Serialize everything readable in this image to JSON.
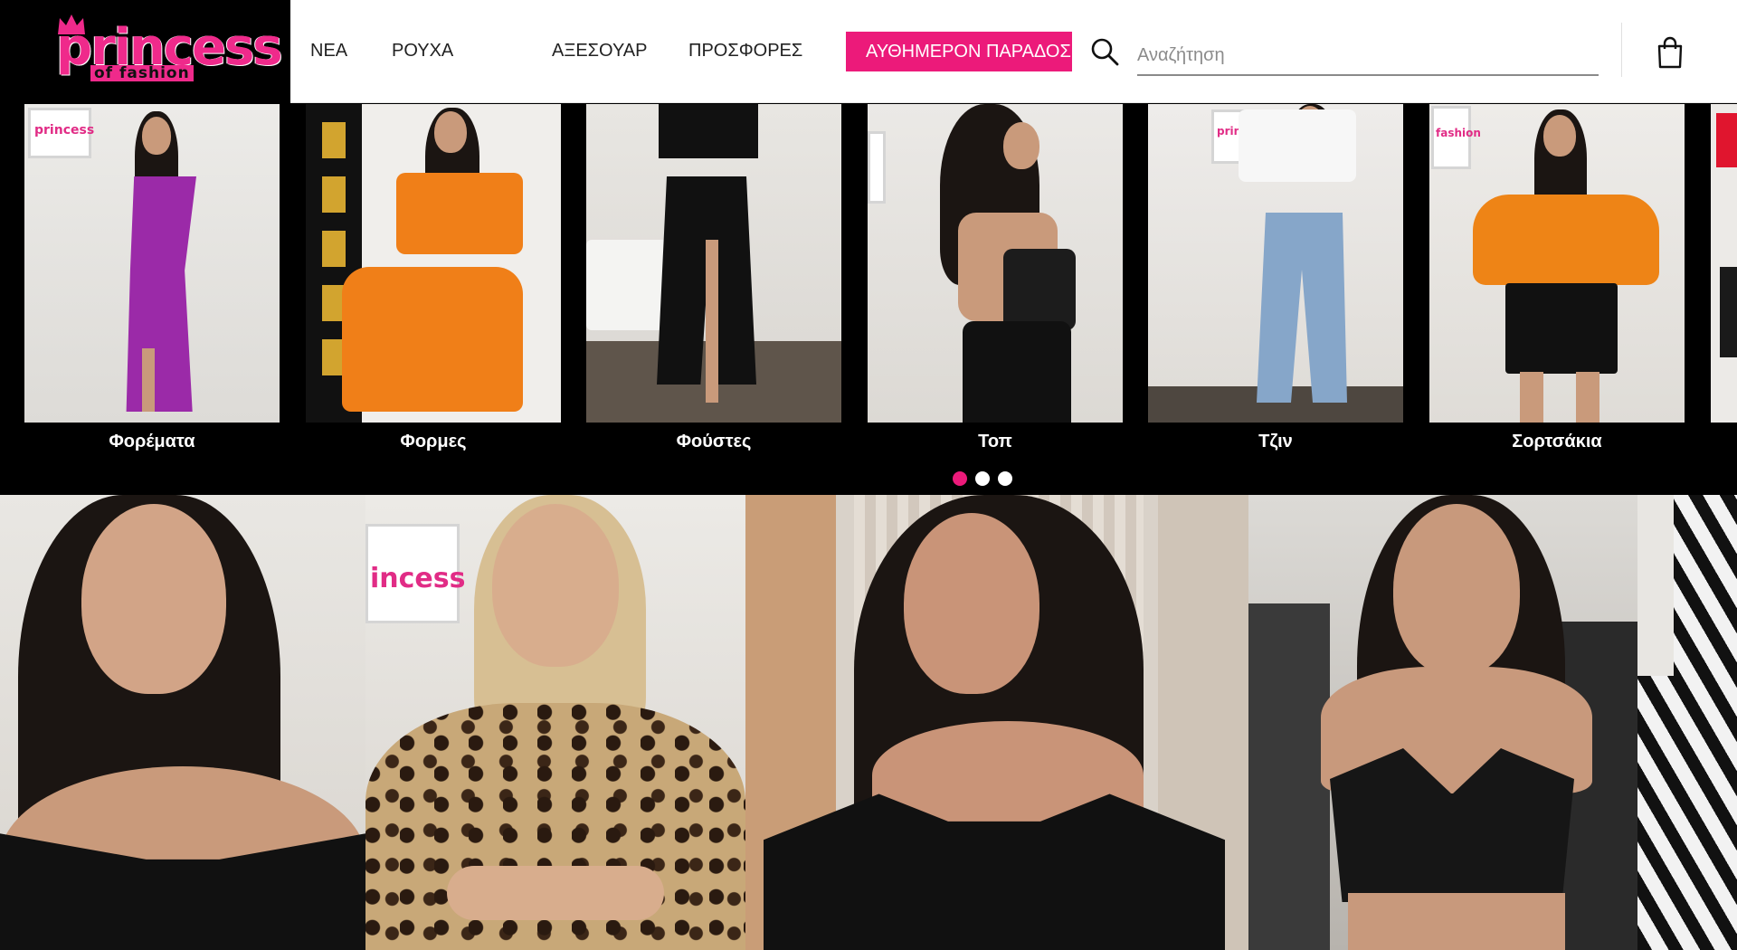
{
  "header": {
    "logo": {
      "main": "princess",
      "sub": "of fashion"
    },
    "nav": [
      {
        "label": "ΝΕΑ"
      },
      {
        "label": "ΡΟΥΧΑ"
      },
      {
        "label": "ΑΞΕΣΟΥΑΡ"
      },
      {
        "label": "ΠΡΟΣΦΟΡΕΣ"
      }
    ],
    "cta_label": "ΑΥΘΗΜΕΡΟΝ ΠΑΡΑΔΟΣΗ",
    "search": {
      "placeholder": "Αναζήτηση",
      "value": ""
    },
    "icons": {
      "search": "search-icon",
      "cart": "shopping-bag-icon"
    }
  },
  "categories": [
    {
      "label": "Φορέματα",
      "outfit_color": "#9b2aa8"
    },
    {
      "label": "Φορμες",
      "outfit_color": "#f07f18"
    },
    {
      "label": "Φούστες",
      "outfit_color": "#111111"
    },
    {
      "label": "Τοπ",
      "outfit_color": "#1c1c1c"
    },
    {
      "label": "Τζιν",
      "outfit_color": "#86a6c9"
    },
    {
      "label": "Σορτσάκια",
      "outfit_color": "#ee8416"
    }
  ],
  "carousel": {
    "dots": 3,
    "active_dot": 0
  },
  "hero": {
    "panels": [
      {
        "outfit": "black off-shoulder top"
      },
      {
        "outfit": "leopard print crop top"
      },
      {
        "outfit": "black lace-up off-shoulder top"
      },
      {
        "outfit": "black leather corset top"
      },
      {
        "outfit": "zebra print"
      }
    ]
  },
  "colors": {
    "brand_pink": "#ec1a7a",
    "header_bg": "#ffffff",
    "carousel_bg": "#000000"
  }
}
